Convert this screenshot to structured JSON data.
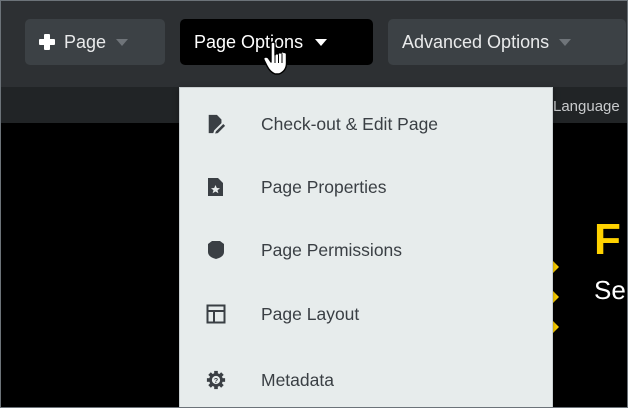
{
  "toolbar": {
    "page_label": "Page",
    "page_options_label": "Page Options",
    "advanced_options_label": "Advanced Options"
  },
  "subbar": {
    "language_text": "Language"
  },
  "banner": {
    "big_text": "F",
    "small_text": "Se"
  },
  "menu": {
    "items": [
      {
        "label": "Check-out & Edit Page",
        "icon": "edit-page-icon"
      },
      {
        "label": "Page Properties",
        "icon": "page-properties-icon"
      },
      {
        "label": "Page Permissions",
        "icon": "shield-icon"
      },
      {
        "label": "Page Layout",
        "icon": "layout-icon"
      },
      {
        "label": "Metadata",
        "icon": "metadata-gear-icon"
      }
    ]
  },
  "colors": {
    "toolbar_bg": "#2d3033",
    "button_bg": "#3c4145",
    "active_button_bg": "#000000",
    "menu_bg": "#e7ecec",
    "menu_text": "#3a3f44",
    "banner_yellow": "#ffd200"
  }
}
